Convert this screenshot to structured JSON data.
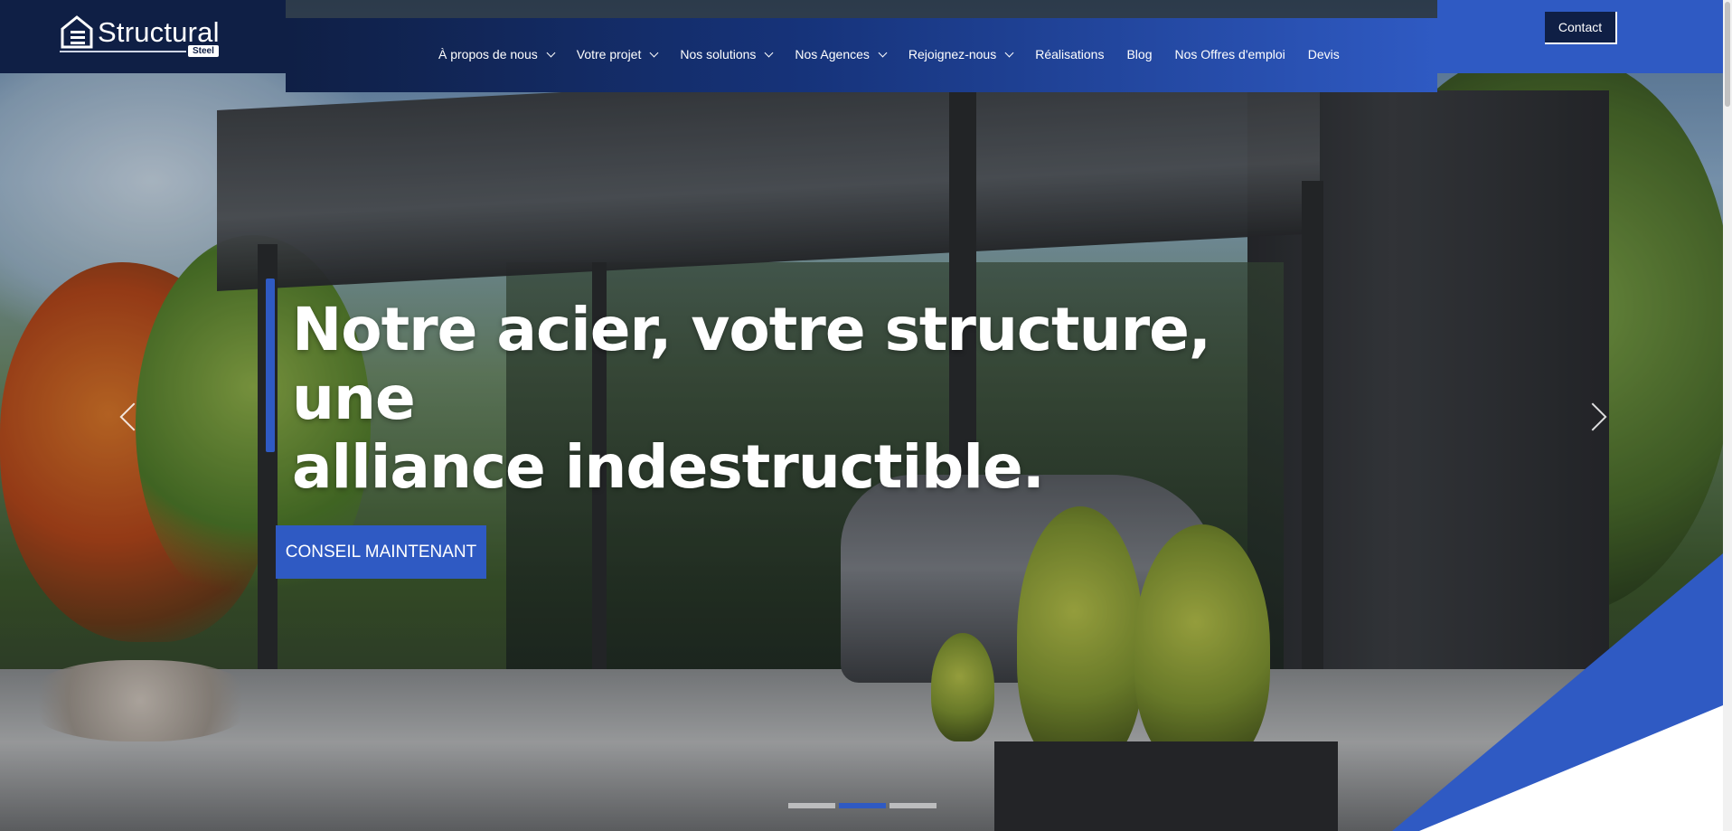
{
  "brand": {
    "name": "Structural",
    "tag": "Steel"
  },
  "nav": {
    "items": [
      {
        "label": "À propos de nous",
        "dropdown": true
      },
      {
        "label": "Votre projet",
        "dropdown": true
      },
      {
        "label": "Nos solutions",
        "dropdown": true
      },
      {
        "label": "Nos Agences",
        "dropdown": true
      },
      {
        "label": "Rejoignez-nous",
        "dropdown": true
      },
      {
        "label": "Réalisations",
        "dropdown": false
      },
      {
        "label": "Blog",
        "dropdown": false
      },
      {
        "label": "Nos Offres d'emploi",
        "dropdown": false
      },
      {
        "label": "Devis",
        "dropdown": false
      }
    ]
  },
  "header": {
    "contact_label": "Contact"
  },
  "hero": {
    "headline_line1": "Notre acier, votre structure, une",
    "headline_line2": "alliance indestructible.",
    "cta_label": "CONSEIL MAINTENANT",
    "slide_count": 3,
    "active_slide": 2
  },
  "colors": {
    "navy": "#0f1f45",
    "accent": "#2f5ac3",
    "white": "#ffffff"
  },
  "icons": {
    "prev": "chevron-left-icon",
    "next": "chevron-right-icon",
    "logo": "house-icon"
  }
}
